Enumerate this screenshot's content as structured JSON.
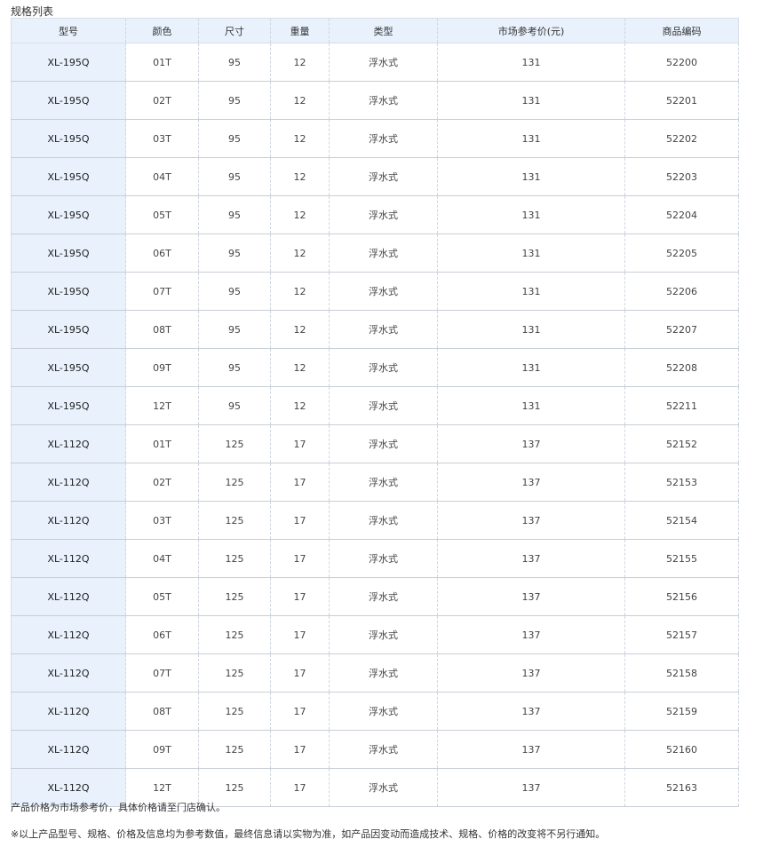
{
  "caption": "规格列表",
  "table": {
    "headers": [
      "型号",
      "颜色",
      "尺寸",
      "重量",
      "类型",
      "市场参考价(元)",
      "商品编码"
    ],
    "rows": [
      [
        "XL-195Q",
        "01T",
        "95",
        "12",
        "浮水式",
        "131",
        "52200"
      ],
      [
        "XL-195Q",
        "02T",
        "95",
        "12",
        "浮水式",
        "131",
        "52201"
      ],
      [
        "XL-195Q",
        "03T",
        "95",
        "12",
        "浮水式",
        "131",
        "52202"
      ],
      [
        "XL-195Q",
        "04T",
        "95",
        "12",
        "浮水式",
        "131",
        "52203"
      ],
      [
        "XL-195Q",
        "05T",
        "95",
        "12",
        "浮水式",
        "131",
        "52204"
      ],
      [
        "XL-195Q",
        "06T",
        "95",
        "12",
        "浮水式",
        "131",
        "52205"
      ],
      [
        "XL-195Q",
        "07T",
        "95",
        "12",
        "浮水式",
        "131",
        "52206"
      ],
      [
        "XL-195Q",
        "08T",
        "95",
        "12",
        "浮水式",
        "131",
        "52207"
      ],
      [
        "XL-195Q",
        "09T",
        "95",
        "12",
        "浮水式",
        "131",
        "52208"
      ],
      [
        "XL-195Q",
        "12T",
        "95",
        "12",
        "浮水式",
        "131",
        "52211"
      ],
      [
        "XL-112Q",
        "01T",
        "125",
        "17",
        "浮水式",
        "137",
        "52152"
      ],
      [
        "XL-112Q",
        "02T",
        "125",
        "17",
        "浮水式",
        "137",
        "52153"
      ],
      [
        "XL-112Q",
        "03T",
        "125",
        "17",
        "浮水式",
        "137",
        "52154"
      ],
      [
        "XL-112Q",
        "04T",
        "125",
        "17",
        "浮水式",
        "137",
        "52155"
      ],
      [
        "XL-112Q",
        "05T",
        "125",
        "17",
        "浮水式",
        "137",
        "52156"
      ],
      [
        "XL-112Q",
        "06T",
        "125",
        "17",
        "浮水式",
        "137",
        "52157"
      ],
      [
        "XL-112Q",
        "07T",
        "125",
        "17",
        "浮水式",
        "137",
        "52158"
      ],
      [
        "XL-112Q",
        "08T",
        "125",
        "17",
        "浮水式",
        "137",
        "52159"
      ],
      [
        "XL-112Q",
        "09T",
        "125",
        "17",
        "浮水式",
        "137",
        "52160"
      ],
      [
        "XL-112Q",
        "12T",
        "125",
        "17",
        "浮水式",
        "137",
        "52163"
      ]
    ]
  },
  "notes": {
    "price_note": "产品价格为市场参考价，具体价格请至门店确认。",
    "disclaimer": "※以上产品型号、规格、价格及信息均为参考数值，最终信息请以实物为准，如产品因变动而造成技术、规格、价格的改变将不另行通知。"
  },
  "colors": {
    "header_bg": "#e8f1fc",
    "model_col_bg": "#e8f1fc",
    "row_border": "#c9ced6",
    "dashed_border": "#cfd6df"
  }
}
